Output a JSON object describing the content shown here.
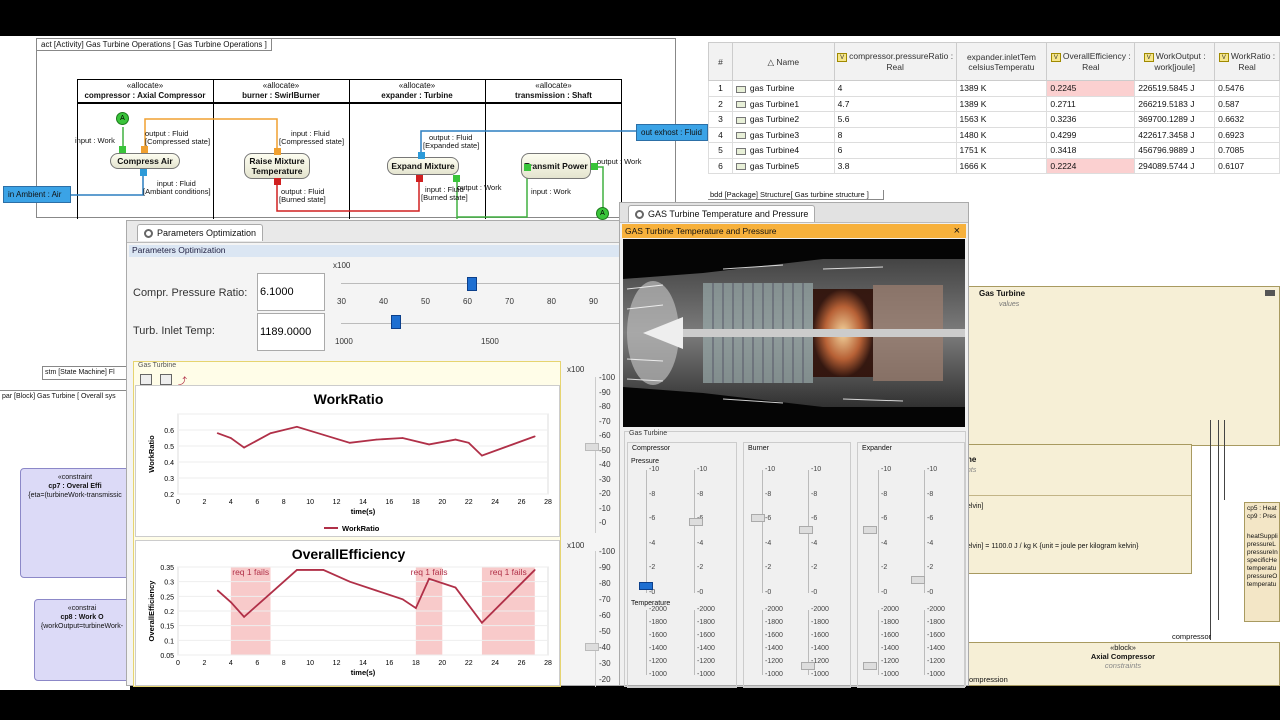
{
  "activity": {
    "tab": "act [Activity] Gas Turbine Operations [ Gas Turbine Operations ]",
    "lanes": [
      {
        "stereo": "«allocate»",
        "name": "compressor : Axial Compressor"
      },
      {
        "stereo": "«allocate»",
        "name": "burner : SwirlBurner"
      },
      {
        "stereo": "«allocate»",
        "name": "expander : Turbine"
      },
      {
        "stereo": "«allocate»",
        "name": "transmission : Shaft"
      }
    ],
    "actions": {
      "compress": "Compress Air",
      "raise": "Raise Mixture Temperature",
      "expand": "Expand Mixture",
      "transmit": "Transmit Power"
    },
    "labels": {
      "input_work": "input : Work",
      "out_fluid_comp": "output : Fluid",
      "comp_state": "[Compressed state]",
      "in_fluid_raise": "input : Fluid",
      "comp_state2": "[Compressed state]",
      "in_fluid_amb": "input : Fluid",
      "amb_cond": "[Ambiant conditions]",
      "out_fluid_burn": "output : Fluid",
      "burn_state": "[Burned state]",
      "out_fluid_exp": "output : Fluid",
      "exp_state": "[Expanded state]",
      "in_fluid_exp": "input : Fluid",
      "burn_state2": "[Burned state]",
      "out_work_exp": "output : Work",
      "in_work_tr": "input : Work",
      "out_work_tr": "output : Work"
    },
    "ambient_port": "in Ambient : Air",
    "exhaust_port": "out exhost : Fluid",
    "pin_a": "A"
  },
  "table": {
    "columns": [
      "#",
      "Name",
      "compressor.pressureRatio : Real",
      "expander.inletTem celsiusTemperatu",
      "OverallEfficiency : Real",
      "WorkOutput : work[joule]",
      "WorkRatio : Real"
    ],
    "rows": [
      {
        "n": "1",
        "name": "gas Turbine",
        "pr": "4",
        "t": "1389 K",
        "eff": "0.2245",
        "wo": "226519.5845 J",
        "wr": "0.5476",
        "hl": true
      },
      {
        "n": "2",
        "name": "gas Turbine1",
        "pr": "4.7",
        "t": "1389 K",
        "eff": "0.2711",
        "wo": "266219.5183 J",
        "wr": "0.587",
        "hl": false
      },
      {
        "n": "3",
        "name": "gas Turbine2",
        "pr": "5.6",
        "t": "1563 K",
        "eff": "0.3236",
        "wo": "369700.1289 J",
        "wr": "0.6632",
        "hl": false
      },
      {
        "n": "4",
        "name": "gas Turbine3",
        "pr": "8",
        "t": "1480 K",
        "eff": "0.4299",
        "wo": "422617.3458 J",
        "wr": "0.6923",
        "hl": false
      },
      {
        "n": "5",
        "name": "gas Turbine4",
        "pr": "6",
        "t": "1751 K",
        "eff": "0.3418",
        "wo": "456796.9889 J",
        "wr": "0.7085",
        "hl": false
      },
      {
        "n": "6",
        "name": "gas Turbine5",
        "pr": "3.8",
        "t": "1666 K",
        "eff": "0.2224",
        "wo": "294089.5744 J",
        "wr": "0.6107",
        "hl": true
      }
    ]
  },
  "bdd": {
    "tab": "bdd [Package] Structure[ Gas turbine structure ]",
    "block_title": "Gas Turbine",
    "block_sub": "values",
    "inner_title": "ne",
    "inner_sub": "nts",
    "inner_lines": [
      "elvin]",
      "elvin] = 1100.0 J / kg  K   {unit = joule per kilogram kelvin}"
    ],
    "cp_lines": [
      "cp5 : Heat",
      "cp9 : Pres"
    ],
    "param_lines": [
      "heatSuppli",
      "pressureL",
      "pressureIn",
      "specificHe",
      "temperatu",
      "pressureO",
      "temperatu"
    ],
    "compressor_label": "compressor",
    "axial_stereo": "«block»",
    "axial_name": "Axial Compressor",
    "axial_sub": "constraints",
    "axial_bottom": "ompression"
  },
  "stm": {
    "tab": "stm [State Machine] Fl"
  },
  "par": {
    "tab": "par [Block] Gas Turbine [ Overall sys",
    "cp7_stereo": "«constraint",
    "cp7_name": "cp7 : Overal Effi",
    "cp7_expr": "{eta=(turbineWork-transmissic",
    "cp8_stereo": "«constrai",
    "cp8_name": "cp8 : Work O",
    "cp8_expr": "{workOutput=turbineWork-"
  },
  "params": {
    "tab": "Parameters Optimization",
    "title": "Parameters Optimization",
    "pr_label": "Compr. Pressure Ratio:",
    "pr_value": "6.1000",
    "ti_label": "Turb. Inlet Temp:",
    "ti_value": "1189.0000",
    "x100": "x100",
    "pr_ticks": [
      "30",
      "40",
      "50",
      "60",
      "70",
      "80",
      "90"
    ],
    "ti_ticks": [
      "1000",
      "1500"
    ],
    "pr_slider_value": 61,
    "ti_slider_value": 1189,
    "group_title": "Gas Turbine",
    "x100_right1": "x100",
    "x100_right2": "x100"
  },
  "temp_window": {
    "tab": "GAS Turbine Temperature and Pressure",
    "title": "GAS Turbine Temperature and Pressure",
    "close": "×",
    "group": "Gas Turbine",
    "sections": [
      "Compressor",
      "Burner",
      "Expander"
    ],
    "pressure_label": "Pressure",
    "temperature_label": "Temperature",
    "pressure_ticks": [
      "10",
      "8",
      "6",
      "4",
      "2",
      "0"
    ],
    "temp_ticks": [
      "2000",
      "1800",
      "1600",
      "1400",
      "1200",
      "1000"
    ]
  },
  "chart_data": [
    {
      "type": "line",
      "title": "WorkRatio",
      "xlabel": "time(s)",
      "ylabel": "WorkRatio",
      "xlim": [
        0,
        28
      ],
      "ylim": [
        0.2,
        0.7
      ],
      "xticks": [
        "0",
        "2",
        "4",
        "6",
        "8",
        "10",
        "12",
        "14",
        "16",
        "18",
        "20",
        "22",
        "24",
        "26",
        "28"
      ],
      "yticks": [
        "0.5",
        "0.4",
        "0.3",
        "0.2",
        "0.6"
      ],
      "series": [
        {
          "name": "WorkRatio",
          "color": "#b03048",
          "x": [
            3,
            4,
            5,
            7,
            9,
            11,
            13,
            15,
            17,
            19,
            21,
            22,
            23,
            27
          ],
          "y": [
            0.58,
            0.55,
            0.49,
            0.58,
            0.62,
            0.57,
            0.52,
            0.54,
            0.55,
            0.51,
            0.54,
            0.52,
            0.44,
            0.56
          ]
        }
      ],
      "legend": "bottom-center"
    },
    {
      "type": "line",
      "title": "OverallEfficiency",
      "xlabel": "time(s)",
      "ylabel": "OverallEfficiency",
      "xlim": [
        0,
        28
      ],
      "ylim": [
        0.05,
        0.35
      ],
      "xticks": [
        "0",
        "2",
        "4",
        "6",
        "8",
        "10",
        "12",
        "14",
        "16",
        "18",
        "20",
        "22",
        "24",
        "26",
        "28"
      ],
      "yticks": [
        "0.35",
        "0.3",
        "0.25",
        "0.2",
        "0.15",
        "0.1",
        "0.05"
      ],
      "series": [
        {
          "name": "OverallEfficiency",
          "color": "#b03048",
          "x": [
            3,
            4,
            5,
            7,
            9,
            11,
            13,
            15,
            17,
            18,
            19,
            21,
            23,
            27
          ],
          "y": [
            0.27,
            0.23,
            0.18,
            0.26,
            0.34,
            0.34,
            0.3,
            0.27,
            0.24,
            0.21,
            0.31,
            0.28,
            0.16,
            0.34
          ]
        }
      ],
      "bands": [
        {
          "x0": 4,
          "x1": 7,
          "label": "req 1 fails"
        },
        {
          "x0": 18,
          "x1": 20,
          "label": "req 1 fails"
        },
        {
          "x0": 23,
          "x1": 27,
          "label": "req 1 fails"
        }
      ]
    }
  ],
  "colors": {
    "accent_blue": "#1e6fd1",
    "highlight": "#fbd0d0",
    "series": "#b03048",
    "band": "#f6b8b8",
    "block": "#f6efd6"
  }
}
